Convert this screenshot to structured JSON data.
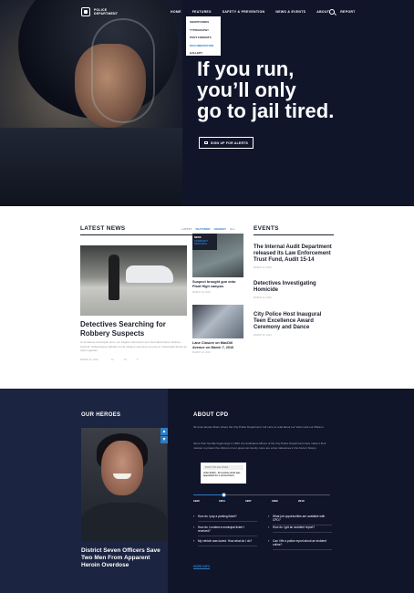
{
  "header": {
    "logo_line1": "POLICE",
    "logo_line2": "DEPARTMENT",
    "nav": [
      "HOME",
      "FEATURES",
      "SAFETY & PREVENTION",
      "NEWS & EVENTS",
      "ABOUT",
      "REPORT"
    ],
    "dropdown": [
      "SHORTCODES",
      "TYPOGRAPHY",
      "POST FORMATS",
      "DOCUMENTATION",
      "GALLERY"
    ],
    "dropdown_active_index": 3
  },
  "hero": {
    "headline_line1": "If you run,",
    "headline_line2": "you’ll only",
    "headline_line3": "go to jail tired.",
    "cta_label": "SIGN UP FOR ALERTS"
  },
  "news": {
    "title": "LATEST NEWS",
    "tabs": [
      "LATEST",
      "FEATURED",
      "HIGHEST",
      "ALL"
    ],
    "main_headline": "Detectives Searching for Robbery Suspects",
    "main_excerpt": "Ut at laoreet consequat uma, nec sagittis velit auctor sed. Sed ullamcorper ultricies pulvinar. Pellentesque habitant morbi tristique senectus et netus et malesuada fames ac turpis egestas.",
    "main_meta": [
      "MARCH 22, 2016",
      "10",
      "15",
      "5"
    ],
    "side_tag_1": "NEWS",
    "side_tag_2": "COMMUNITY",
    "side_tag_3": "RESEARCH",
    "side1_caption": "Suspect brought gun onto Plant High campus",
    "side1_date": "MARCH 22, 2016",
    "side2_caption": "Lane Closure on MacDill Avenue on March 7, 2016",
    "side2_date": "MARCH 22, 2016"
  },
  "events": {
    "title": "EVENTS",
    "items": [
      {
        "title": "The Internal Audit Department released its Law Enforcement Trust Fund, Audit 15-14",
        "date": "MARCH 22, 2016"
      },
      {
        "title": "Detectives Investigating Homicide",
        "date": "MARCH 22, 2016"
      },
      {
        "title": "City Police Host Inaugural Teen Excellence Award Ceremony and Dance",
        "date": "MARCH 22, 2016"
      }
    ]
  },
  "heroes": {
    "title": "OUR HEROES",
    "caption": "District Seven Officers Save Two Men From Apparent Heroin Overdose"
  },
  "about": {
    "title": "ABOUT CPD",
    "p1": "Sit amet laoreet libero where the City Police Department, tell more to read about our Vision and our Mission.",
    "p2": "Since their humble beginnings in 1920, the dedicated officers of the City Police Department have made it their mission to protect the citizens of our great community. Here are a few milestones in the force's history.",
    "timeline_box_title": "FIRST POLICE CHIEF",
    "timeline_box_text": "John Smith - first police chief was appointed for a second term.",
    "years": [
      "1920",
      "1954",
      "1967",
      "1990",
      "2010"
    ],
    "faq": [
      "How do I pay a parking ticket?",
      "What job opportunities are available with CPD?",
      "How do I contest a municipal ticket I received?",
      "How do I get an accident report?",
      "My vehicle was towed. How what do I do?",
      "Can I file a police report about an incident online?"
    ],
    "more": "MORE INFO"
  }
}
